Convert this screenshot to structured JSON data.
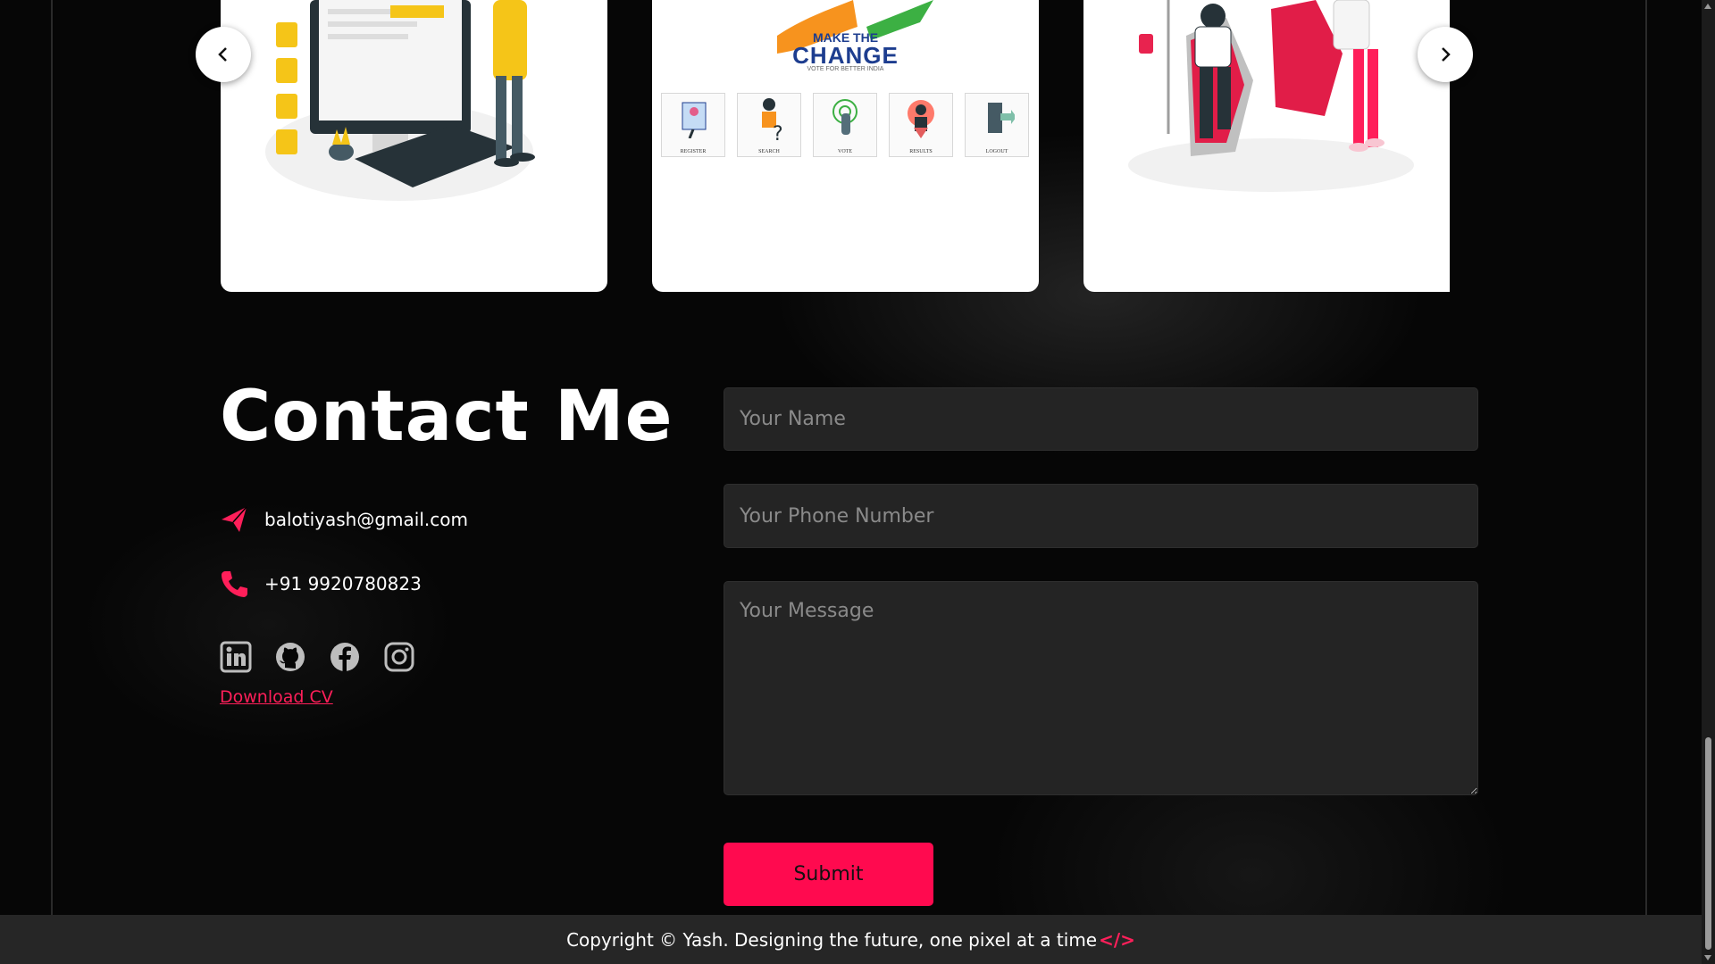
{
  "colors": {
    "accent": "#ff0a4f",
    "field_bg": "#242424",
    "footer_bg": "#262626",
    "page_bg": "#000000"
  },
  "carousel": {
    "prev_icon": "chevron-left-icon",
    "next_icon": "chevron-right-icon",
    "cards": [
      {
        "image": "quiz-illustration"
      },
      {
        "image": "voting-app-preview",
        "heading_small": "MAKE THE",
        "heading_big": "CHANGE",
        "tagline": "VOTE FOR BETTER INDIA",
        "steps": [
          "REGISTER",
          "SEARCH",
          "VOTE",
          "RESULTS",
          "LOGOUT"
        ]
      },
      {
        "image": "blood-donation-illustration"
      }
    ]
  },
  "contact": {
    "title": "Contact Me",
    "email_icon": "paper-plane-icon",
    "email": "balotiyash@gmail.com",
    "phone_icon": "phone-icon",
    "phone": "+91 9920780823",
    "socials": [
      "linkedin-icon",
      "github-icon",
      "facebook-icon",
      "instagram-icon"
    ],
    "download_label": "Download CV"
  },
  "form": {
    "name_placeholder": "Your Name",
    "phone_placeholder": "Your Phone Number",
    "message_placeholder": "Your Message",
    "submit_label": "Submit"
  },
  "footer": {
    "text": "Copyright © Yash. Designing the future, one pixel at a time",
    "code_symbol": "</>"
  }
}
